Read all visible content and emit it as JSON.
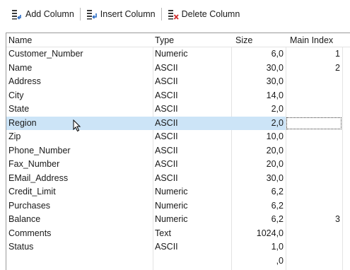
{
  "toolbar": {
    "add_column": "Add Column",
    "insert_column": "Insert Column",
    "delete_column": "Delete Column",
    "icons": [
      "add-column-icon",
      "insert-column-icon",
      "delete-column-icon"
    ]
  },
  "grid": {
    "headers": {
      "name": "Name",
      "type": "Type",
      "size": "Size",
      "main_index": "Main Index"
    },
    "rows": [
      {
        "name": "Customer_Number",
        "type": "Numeric",
        "size": "6,0",
        "main_index": "1"
      },
      {
        "name": "Name",
        "type": "ASCII",
        "size": "30,0",
        "main_index": "2"
      },
      {
        "name": "Address",
        "type": "ASCII",
        "size": "30,0",
        "main_index": ""
      },
      {
        "name": "City",
        "type": "ASCII",
        "size": "14,0",
        "main_index": ""
      },
      {
        "name": "State",
        "type": "ASCII",
        "size": "2,0",
        "main_index": ""
      },
      {
        "name": "Region",
        "type": "ASCII",
        "size": "2,0",
        "main_index": ""
      },
      {
        "name": "Zip",
        "type": "ASCII",
        "size": "10,0",
        "main_index": ""
      },
      {
        "name": "Phone_Number",
        "type": "ASCII",
        "size": "20,0",
        "main_index": ""
      },
      {
        "name": "Fax_Number",
        "type": "ASCII",
        "size": "20,0",
        "main_index": ""
      },
      {
        "name": "EMail_Address",
        "type": "ASCII",
        "size": "30,0",
        "main_index": ""
      },
      {
        "name": "Credit_Limit",
        "type": "Numeric",
        "size": "6,2",
        "main_index": ""
      },
      {
        "name": "Purchases",
        "type": "Numeric",
        "size": "6,2",
        "main_index": ""
      },
      {
        "name": "Balance",
        "type": "Numeric",
        "size": "6,2",
        "main_index": "3"
      },
      {
        "name": "Comments",
        "type": "Text",
        "size": "1024,0",
        "main_index": ""
      },
      {
        "name": "Status",
        "type": "ASCII",
        "size": "1,0",
        "main_index": ""
      },
      {
        "name": "",
        "type": "",
        "size": ",0",
        "main_index": ""
      }
    ],
    "selected_row": 5
  },
  "colors": {
    "selection": "#cce4f7",
    "icon_blue": "#2b6cc4",
    "icon_red": "#d02c2c",
    "icon_dark": "#3a3a3a"
  }
}
